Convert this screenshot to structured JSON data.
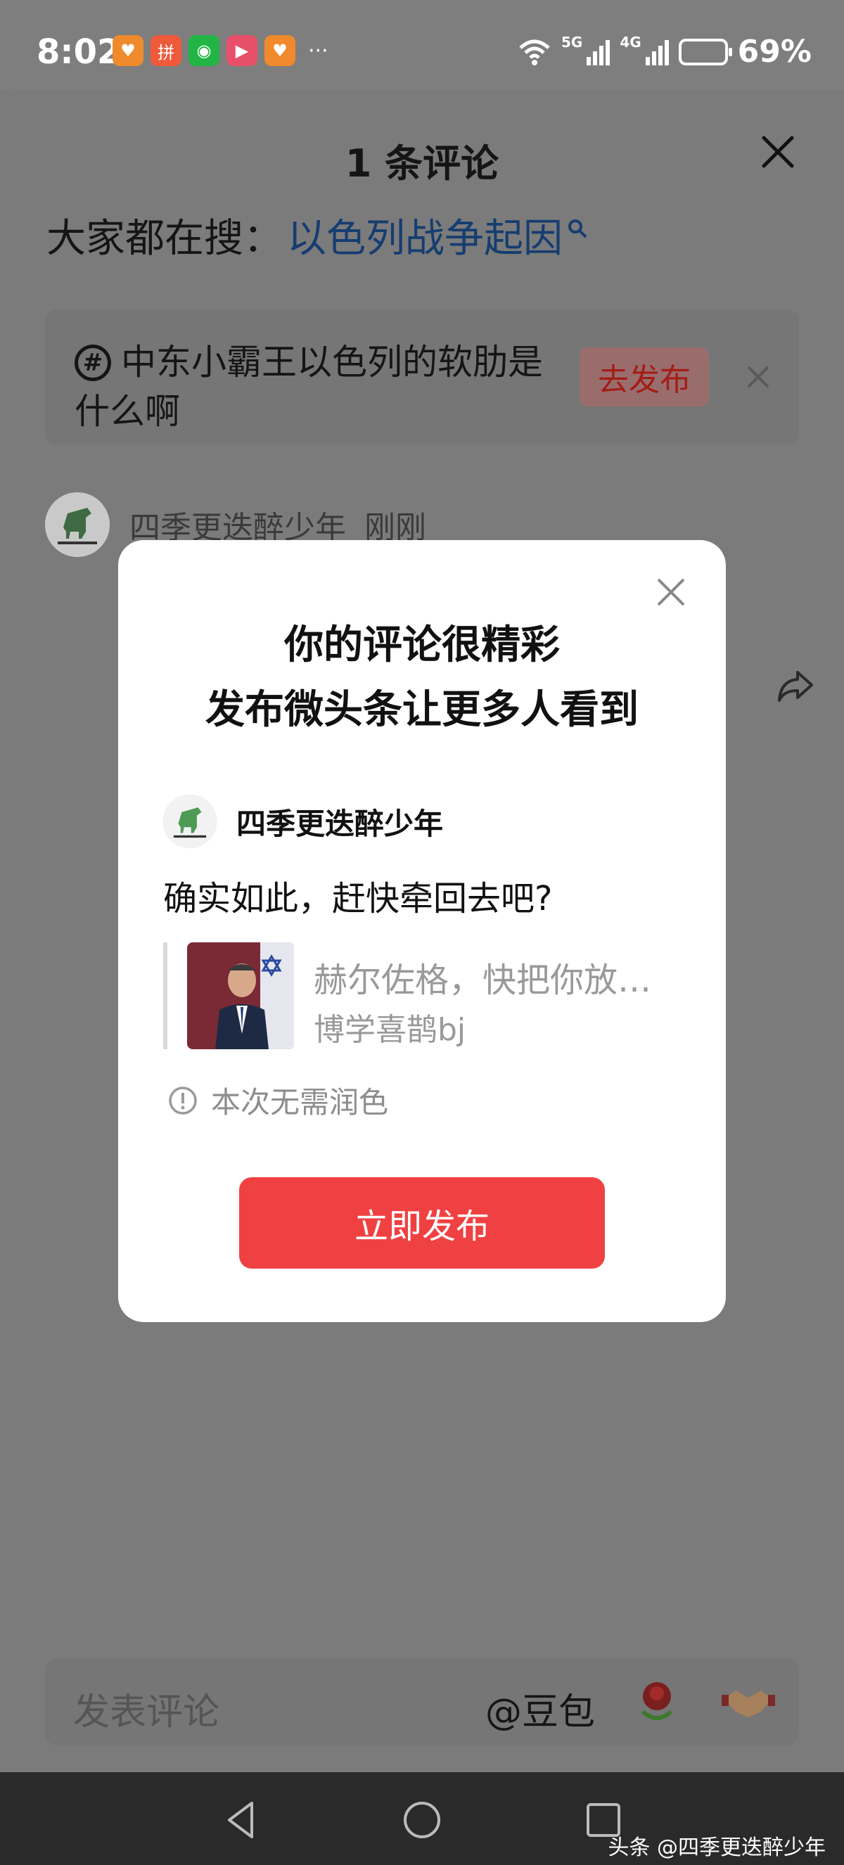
{
  "status_bar": {
    "time": "8:02",
    "battery": "69%",
    "signal1": "5G",
    "signal2": "4G",
    "more": "···"
  },
  "sheet": {
    "title": "1 条评论",
    "search_prefix": "大家都在搜：",
    "search_keyword": "以色列战争起因",
    "topic": {
      "hash": "#",
      "text": "中东小霸王以色列的软肋是什么啊",
      "button": "去发布"
    },
    "comment": {
      "username": "四季更迭醉少年",
      "time": "刚刚"
    },
    "input_placeholder": "发表评论",
    "mention": "@豆包"
  },
  "modal": {
    "title_line1": "你的评论很精彩",
    "title_line2": "发布微头条让更多人看到",
    "username": "四季更迭醉少年",
    "comment_text": "确实如此，赶快牵回去吧?",
    "quote_title": "赫尔佐格，快把你放…",
    "quote_author": "博学喜鹊bj",
    "notice": "本次无需润色",
    "publish_button": "立即发布"
  },
  "watermark": "头条 @四季更迭醉少年",
  "colors": {
    "accent_red": "#f04142",
    "link_blue": "#153d70",
    "overlay": "#7b7b7b"
  }
}
